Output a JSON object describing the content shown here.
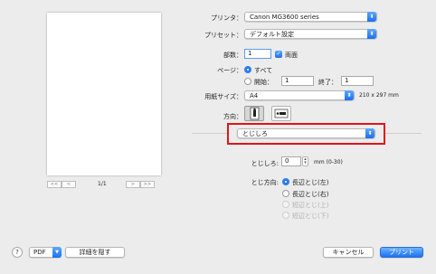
{
  "preview": {
    "page_indicator": "1/1",
    "first_icon": "<<",
    "prev_icon": "<",
    "next_icon": ">",
    "last_icon": ">>"
  },
  "printer": {
    "label": "プリンタ：",
    "value": "Canon MG3600 series"
  },
  "preset": {
    "label": "プリセット：",
    "value": "デフォルト設定"
  },
  "copies": {
    "label": "部数：",
    "value": "1",
    "duplex_label": "両面",
    "duplex_checked": true
  },
  "pages": {
    "label": "ページ：",
    "all_label": "すべて",
    "from_label": "開始：",
    "from_value": "1",
    "to_label": "終了：",
    "to_value": "1"
  },
  "paper_size": {
    "label": "用紙サイズ：",
    "value": "A4",
    "dimensions": "210 x 297 mm"
  },
  "orientation": {
    "label": "方向："
  },
  "section_menu": {
    "value": "とじしろ"
  },
  "margin": {
    "label": "とじしろ:",
    "value": "0",
    "unit": "mm (0-30)"
  },
  "binding": {
    "label": "とじ方向:",
    "options": [
      "長辺とじ(左)",
      "長辺とじ(右)",
      "短辺とじ(上)",
      "短辺とじ(下)"
    ]
  },
  "footer": {
    "help": "?",
    "pdf": "PDF",
    "hide_details": "詳細を隠す",
    "cancel": "キャンセル",
    "print": "プリント"
  },
  "colors": {
    "accent": "#1a6ff0",
    "highlight_box": "#e0141b"
  }
}
